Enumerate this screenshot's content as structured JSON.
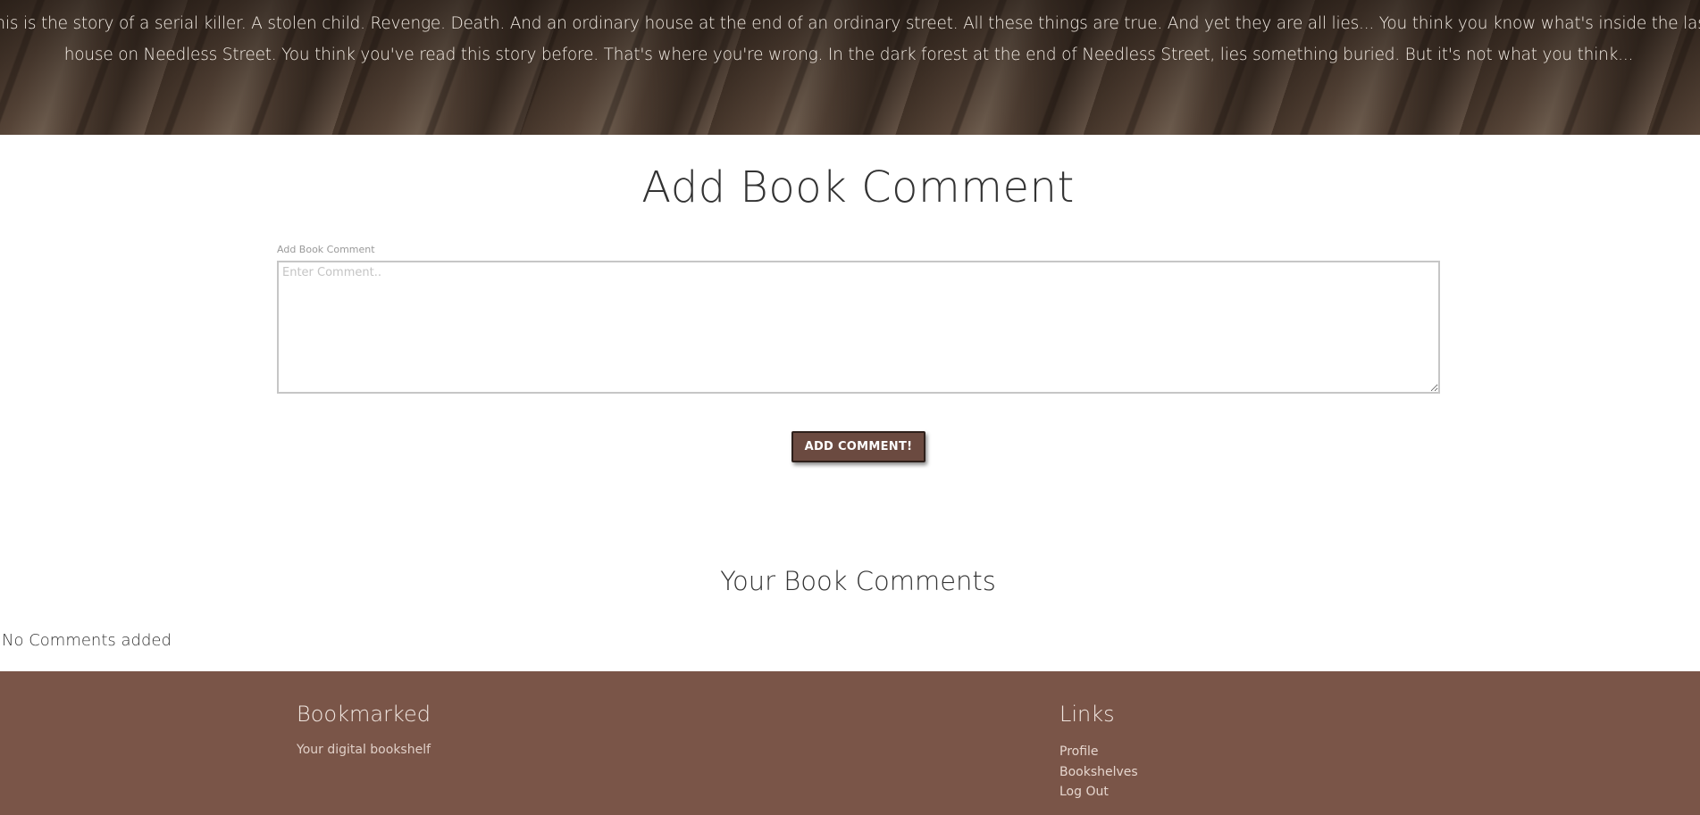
{
  "hero": {
    "description": "This is the story of a serial killer. A stolen child. Revenge. Death. And an ordinary house at the end of an ordinary street. All these things are true. And yet they are all lies... You think you know what's inside the last house on Needless Street. You think you've read this story before. That's where you're wrong. In the dark forest at the end of Needless Street, lies something buried. But it's not what you think..."
  },
  "add_comment": {
    "title": "Add Book Comment",
    "field_label": "Add Book Comment",
    "placeholder": "Enter Comment..",
    "value": "",
    "button_label": "ADD COMMENT!",
    "button_color": "#6b4a40"
  },
  "comments": {
    "heading": "Your Book Comments",
    "empty_message": "No Comments added",
    "items": []
  },
  "footer": {
    "background_color": "#7a5548",
    "brand": {
      "title": "Bookmarked",
      "tagline": "Your digital bookshelf"
    },
    "links": {
      "title": "Links",
      "items": [
        {
          "label": "Profile"
        },
        {
          "label": "Bookshelves"
        },
        {
          "label": "Log Out"
        }
      ]
    }
  }
}
